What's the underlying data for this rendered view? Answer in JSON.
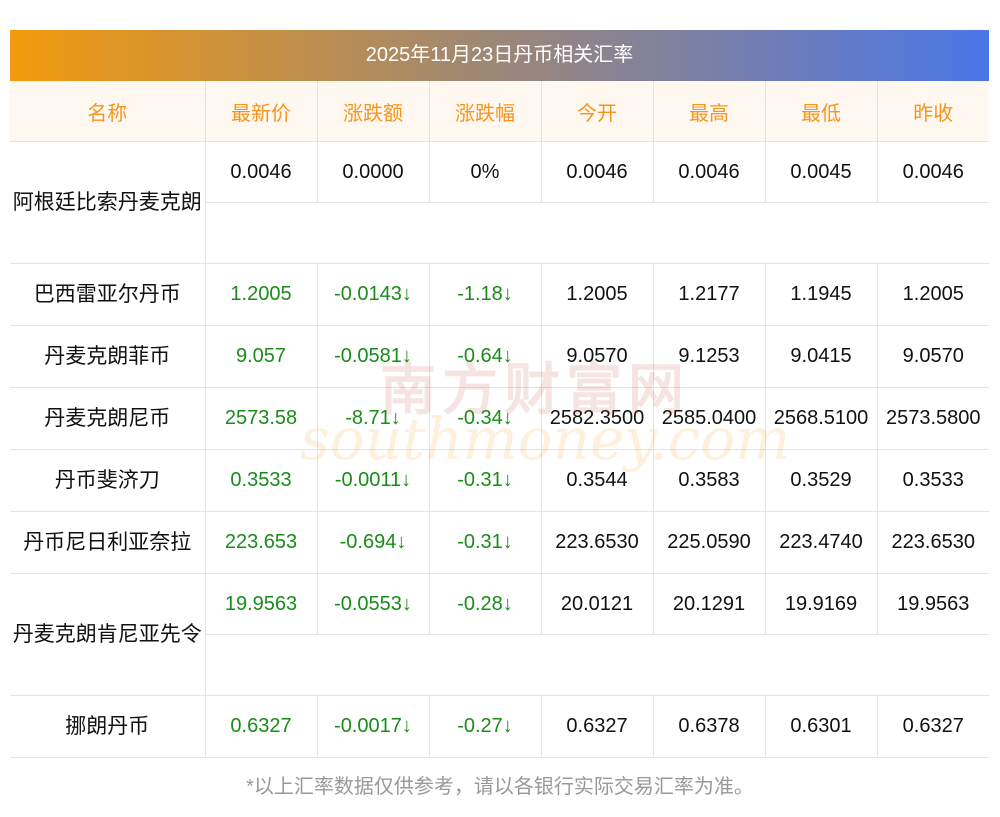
{
  "title": "2025年11月23日丹币相关汇率",
  "headers": [
    "名称",
    "最新价",
    "涨跌额",
    "涨跌幅",
    "今开",
    "最高",
    "最低",
    "昨收"
  ],
  "rows": [
    {
      "name": "阿根廷比索丹麦克朗",
      "wrap": true,
      "latest": "0.0046",
      "change": "0.0000",
      "pct": "0%",
      "open": "0.0046",
      "high": "0.0046",
      "low": "0.0045",
      "prev": "0.0046",
      "colored": false
    },
    {
      "name": "巴西雷亚尔丹币",
      "wrap": false,
      "latest": "1.2005",
      "change": "-0.0143↓",
      "pct": "-1.18↓",
      "open": "1.2005",
      "high": "1.2177",
      "low": "1.1945",
      "prev": "1.2005",
      "colored": true
    },
    {
      "name": "丹麦克朗菲币",
      "wrap": false,
      "latest": "9.057",
      "change": "-0.0581↓",
      "pct": "-0.64↓",
      "open": "9.0570",
      "high": "9.1253",
      "low": "9.0415",
      "prev": "9.0570",
      "colored": true
    },
    {
      "name": "丹麦克朗尼币",
      "wrap": false,
      "latest": "2573.58",
      "change": "-8.71↓",
      "pct": "-0.34↓",
      "open": "2582.3500",
      "high": "2585.0400",
      "low": "2568.5100",
      "prev": "2573.5800",
      "colored": true
    },
    {
      "name": "丹币斐济刀",
      "wrap": false,
      "latest": "0.3533",
      "change": "-0.0011↓",
      "pct": "-0.31↓",
      "open": "0.3544",
      "high": "0.3583",
      "low": "0.3529",
      "prev": "0.3533",
      "colored": true
    },
    {
      "name": "丹币尼日利亚奈拉",
      "wrap": false,
      "latest": "223.653",
      "change": "-0.694↓",
      "pct": "-0.31↓",
      "open": "223.6530",
      "high": "225.0590",
      "low": "223.4740",
      "prev": "223.6530",
      "colored": true
    },
    {
      "name": "丹麦克朗肯尼亚先令",
      "wrap": true,
      "latest": "19.9563",
      "change": "-0.0553↓",
      "pct": "-0.28↓",
      "open": "20.0121",
      "high": "20.1291",
      "low": "19.9169",
      "prev": "19.9563",
      "colored": true
    },
    {
      "name": "挪朗丹币",
      "wrap": false,
      "latest": "0.6327",
      "change": "-0.0017↓",
      "pct": "-0.27↓",
      "open": "0.6327",
      "high": "0.6378",
      "low": "0.6301",
      "prev": "0.6327",
      "colored": true
    }
  ],
  "watermark": {
    "cn": "南方财富网",
    "en": "southmoney.com"
  },
  "footer": "*以上汇率数据仅供参考，请以各银行实际交易汇率为准。",
  "colors": {
    "header_text": "#f7941d",
    "green": "#1a8c1a",
    "title_start": "#f29a0c",
    "title_end": "#4a76e8"
  }
}
